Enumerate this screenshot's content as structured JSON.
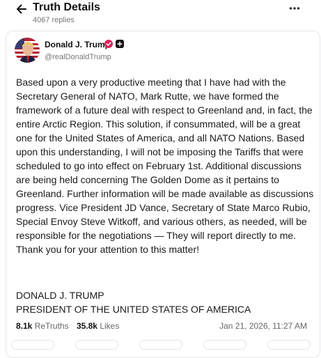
{
  "header": {
    "title": "Truth Details",
    "reply_count": "4067 replies",
    "back_icon": "arrow-left-icon",
    "more_icon": "more-horizontal-icon"
  },
  "author": {
    "name": "Donald J. Trump",
    "handle": "@realDonaldTrump",
    "verified_icon": "verified-badge-icon",
    "verified_color": "#e0245e"
  },
  "post": {
    "body": "Based upon a very productive meeting that I have had with the Secretary General of NATO, Mark Rutte, we have formed the framework of a future deal with respect to Greenland and, in fact, the entire Arctic Region. This solution, if consummated, will be a great one for the United States of America, and all NATO Nations. Based upon this understanding, I will not be imposing the Tariffs that were scheduled to go into effect on February 1st. Additional discussions are being held concerning The Golden Dome as it pertains to Greenland. Further information will be made available as discussions progress. Vice President JD Vance, Secretary of State Marco Rubio, Special Envoy Steve Witkoff, and various others, as needed, will be responsible for the negotiations — They will report directly to me. Thank you for your attention to this matter!",
    "signature_line1": "DONALD J. TRUMP",
    "signature_line2": "PRESIDENT OF THE UNITED STATES OF AMERICA"
  },
  "stats": {
    "retruths_count": "8.1k",
    "retruths_label": "ReTruths",
    "likes_count": "35.8k",
    "likes_label": "Likes",
    "timestamp": "Jan 21, 2026, 11:27 AM"
  }
}
